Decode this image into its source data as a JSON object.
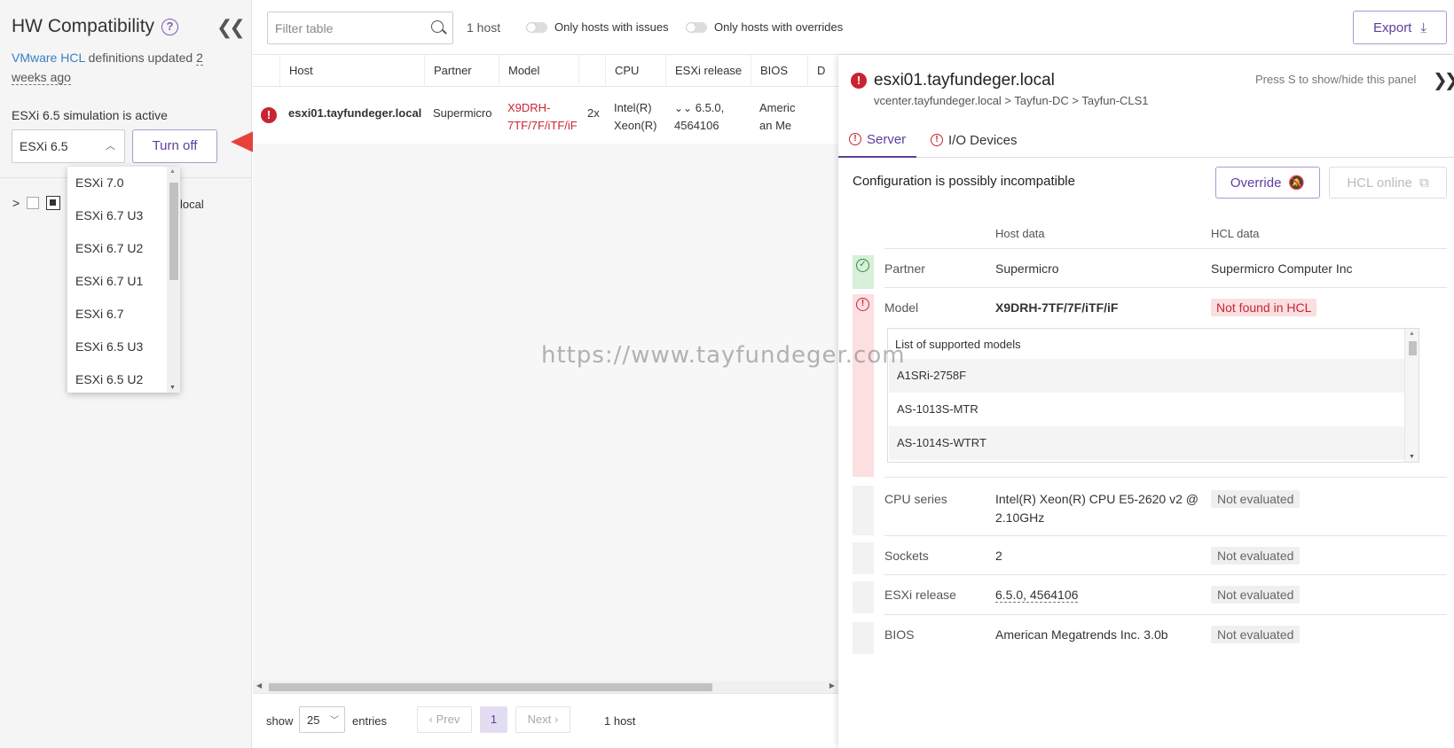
{
  "sidebar": {
    "title": "HW Compatibility",
    "hcl_link": "VMware HCL",
    "hcl_text": " definitions updated ",
    "hcl_age": "2 weeks ago",
    "simulation_text": "ESXi 6.5 simulation is active",
    "version_selected": "ESXi 6.5",
    "turn_off_label": "Turn off",
    "tree_host_suffix": "local",
    "version_options": [
      "ESXi 7.0",
      "ESXi 6.7 U3",
      "ESXi 6.7 U2",
      "ESXi 6.7 U1",
      "ESXi 6.7",
      "ESXi 6.5 U3",
      "ESXi 6.5 U2"
    ]
  },
  "toolbar": {
    "filter_placeholder": "Filter table",
    "host_count": "1 host",
    "toggle_issues": "Only hosts with issues",
    "toggle_overrides": "Only hosts with overrides",
    "export_label": "Export"
  },
  "table": {
    "columns": [
      "Host",
      "Partner",
      "Model",
      "CPU",
      "ESXi release",
      "BIOS",
      "D"
    ],
    "row": {
      "host": "esxi01.tayfundeger.local",
      "partner": "Supermicro",
      "model": "X9DRH-7TF/7F/iTF/iF",
      "cpu_count": "2x",
      "cpu": "Intel(R) Xeon(R)",
      "esxi_release": "6.5.0, 4564106",
      "bios": "Americ an Me"
    }
  },
  "pagination": {
    "show_label": "show",
    "page_size": "25",
    "entries_label": "entries",
    "prev_label": "Prev",
    "current_page": "1",
    "next_label": "Next",
    "host_count": "1 host"
  },
  "panel": {
    "title": "esxi01.tayfundeger.local",
    "path": "vcenter.tayfundeger.local > Tayfun-DC > Tayfun-CLS1",
    "hint": "Press S to show/hide this panel",
    "tabs": [
      "Server",
      "I/O Devices"
    ],
    "config_status": "Configuration is possibly incompatible",
    "override_label": "Override",
    "hcl_online_label": "HCL online",
    "col_host": "Host data",
    "col_hcl": "HCL data",
    "rows": {
      "partner": {
        "label": "Partner",
        "host": "Supermicro",
        "hcl": "Supermicro Computer Inc"
      },
      "model": {
        "label": "Model",
        "host": "X9DRH-7TF/7F/iTF/iF",
        "hcl": "Not found in HCL"
      },
      "cpu": {
        "label": "CPU series",
        "host": "Intel(R) Xeon(R) CPU E5-2620 v2 @ 2.10GHz",
        "hcl": "Not evaluated"
      },
      "sockets": {
        "label": "Sockets",
        "host": "2",
        "hcl": "Not evaluated"
      },
      "esxi": {
        "label": "ESXi release",
        "host": "6.5.0, 4564106",
        "hcl": "Not evaluated"
      },
      "bios": {
        "label": "BIOS",
        "host": "American Megatrends Inc. 3.0b",
        "hcl": "Not evaluated"
      }
    },
    "models_heading": "List of supported models",
    "models": [
      "A1SRi-2758F",
      "AS-1013S-MTR",
      "AS-1014S-WTRT"
    ]
  },
  "watermark": "https://www.tayfundeger.com",
  "colors": {
    "accent": "#5b3fa0",
    "error": "#c92432",
    "link": "#3a7ec2"
  }
}
